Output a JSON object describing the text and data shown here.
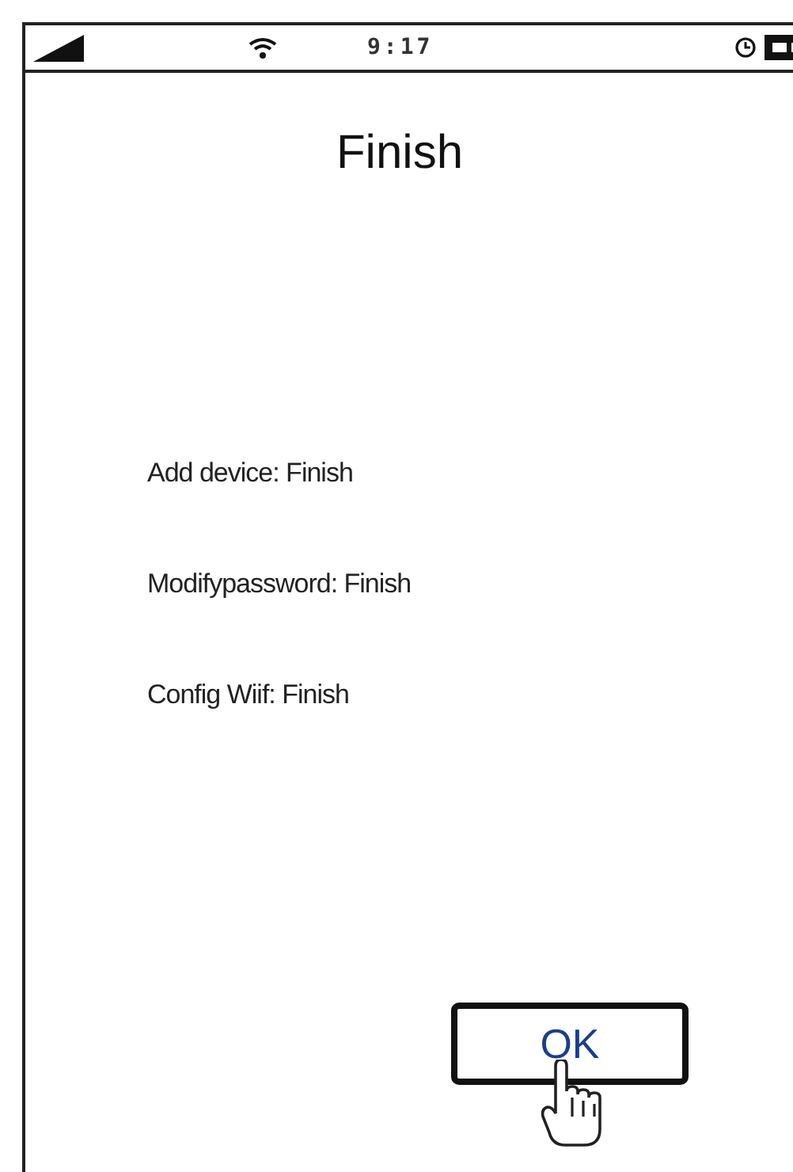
{
  "status_bar": {
    "time": "9:17"
  },
  "title": "Finish",
  "results": [
    "Add device: Finish",
    "Modifypassword: Finish",
    "Config  Wiif: Finish"
  ],
  "buttons": [
    {
      "label": "OK"
    }
  ]
}
